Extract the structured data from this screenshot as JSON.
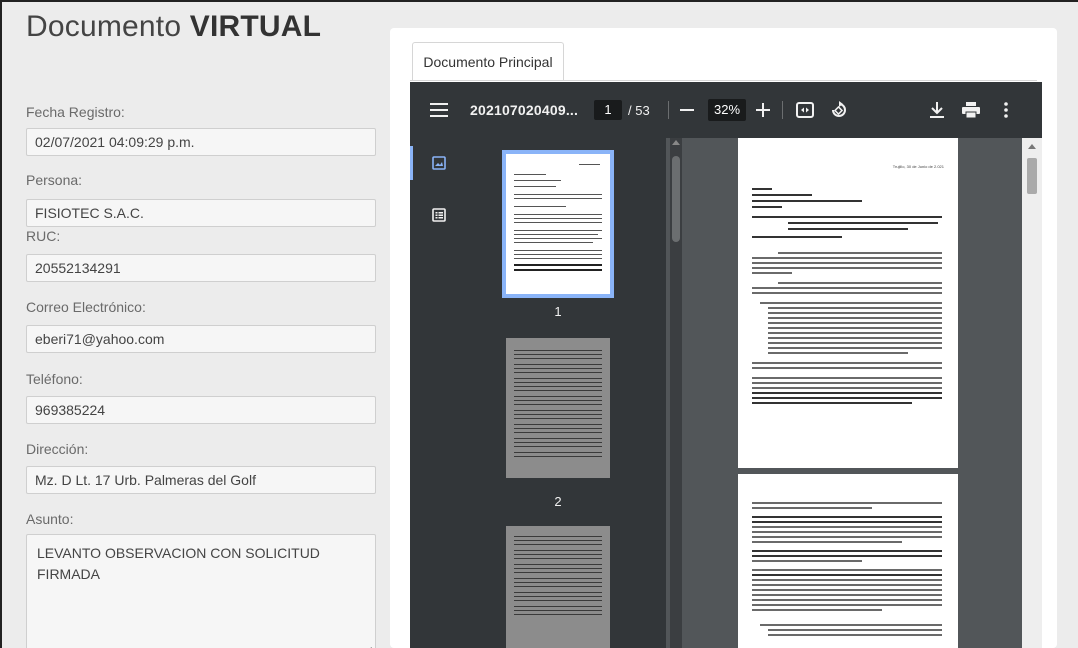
{
  "form": {
    "title_prefix": "Documento",
    "title_strong": "VIRTUAL",
    "fields": [
      {
        "label": "Fecha Registro:",
        "value": "02/07/2021 04:09:29 p.m."
      },
      {
        "label": "Persona:",
        "value": "FISIOTEC S.A.C."
      },
      {
        "label": "RUC:",
        "value": "20552134291"
      },
      {
        "label": "Correo Electrónico:",
        "value": "eberi71@yahoo.com"
      },
      {
        "label": "Teléfono:",
        "value": "969385224"
      },
      {
        "label": "Dirección:",
        "value": "Mz. D Lt. 17 Urb. Palmeras del Golf"
      }
    ],
    "asunto_label": "Asunto:",
    "asunto_value": "LEVANTO OBSERVACION CON SOLICITUD FIRMADA"
  },
  "tabs": [
    {
      "label": "Documento Principal",
      "active": true
    }
  ],
  "viewer": {
    "doc_name": "202107020409...",
    "current_page": "1",
    "page_total": "/ 53",
    "zoom": "32%",
    "thumbnails": [
      {
        "number": "1",
        "selected": true
      },
      {
        "number": "2",
        "selected": false
      }
    ],
    "page_header_date": "Trujillo, 30 de Junio de 2.021",
    "icons": [
      "menu-icon",
      "zoom-out-icon",
      "zoom-in-icon",
      "fit-page-icon",
      "rotate-icon",
      "download-icon",
      "print-icon",
      "more-icon",
      "thumbnails-icon",
      "outline-icon"
    ]
  },
  "colors": {
    "toolbar": "#323639",
    "viewer_bg": "#525659",
    "accent": "#8ab4f8"
  }
}
